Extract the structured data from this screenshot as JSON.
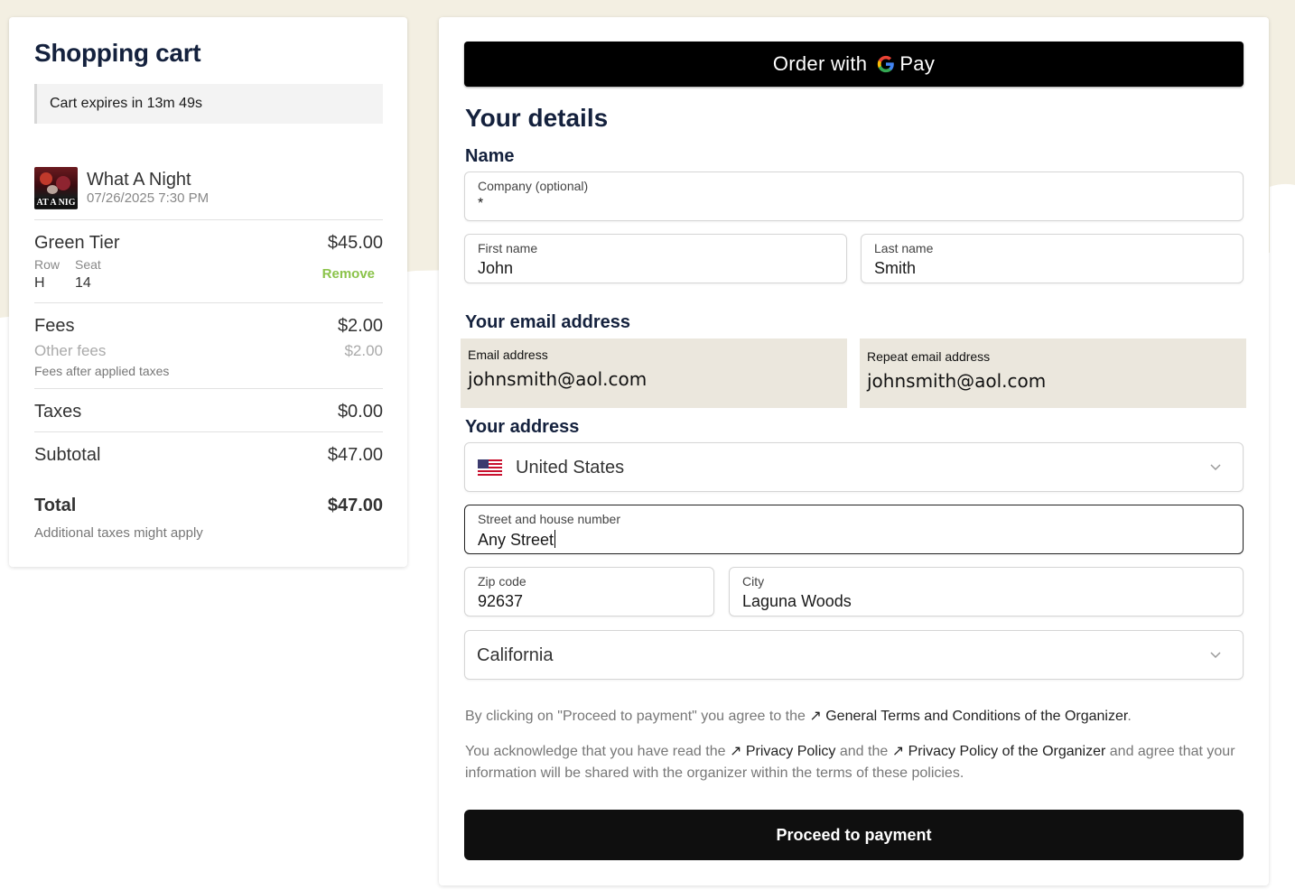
{
  "colors": {
    "band": "#f3efe2",
    "accent_remove": "#8bc34a",
    "button_bg": "#0f0f0f"
  },
  "cart": {
    "title": "Shopping cart",
    "expires": "Cart expires in 13m 49s",
    "event": {
      "thumb_text": "AT A NIG",
      "name": "What A Night",
      "datetime": "07/26/2025 7:30 PM"
    },
    "ticket": {
      "tier": "Green Tier",
      "price": "$45.00",
      "row_label": "Row",
      "seat_label": "Seat",
      "row": "H",
      "seat": "14",
      "remove_label": "Remove"
    },
    "fees": {
      "label": "Fees",
      "amount": "$2.00",
      "other_label": "Other fees",
      "other_amount": "$2.00",
      "note": "Fees after applied taxes"
    },
    "taxes": {
      "label": "Taxes",
      "amount": "$0.00"
    },
    "subtotal": {
      "label": "Subtotal",
      "amount": "$47.00"
    },
    "total": {
      "label": "Total",
      "amount": "$47.00",
      "note": "Additional taxes might apply"
    }
  },
  "details": {
    "gpay": {
      "prefix": "Order with",
      "brand": "Pay"
    },
    "title": "Your details",
    "name_section": "Name",
    "company": {
      "label": "Company (optional)",
      "value": "*"
    },
    "first_name": {
      "label": "First name",
      "value": "John"
    },
    "last_name": {
      "label": "Last name",
      "value": "Smith"
    },
    "email_section": "Your email address",
    "email": {
      "label": "Email address",
      "value": "johnsmith@aol.com"
    },
    "email_repeat": {
      "label": "Repeat email address",
      "value": "johnsmith@aol.com"
    },
    "address_section": "Your address",
    "country": {
      "value": "United States",
      "icon": "us-flag-icon"
    },
    "street": {
      "label": "Street and house number",
      "value": "Any Street"
    },
    "zip": {
      "label": "Zip code",
      "value": "92637"
    },
    "city": {
      "label": "City",
      "value": "Laguna Woods"
    },
    "state": {
      "value": "California"
    },
    "legal1": {
      "pre": "By clicking on \"Proceed to payment\" you agree to the",
      "link": "General Terms and Conditions of the Organizer",
      "post": "."
    },
    "legal2": {
      "pre": "You acknowledge that you have read the",
      "link1": "Privacy Policy",
      "mid": "and the",
      "link2": "Privacy Policy of the Organizer",
      "post": "and agree that your information will be shared with the organizer within the terms of these policies."
    },
    "proceed_label": "Proceed to payment"
  }
}
